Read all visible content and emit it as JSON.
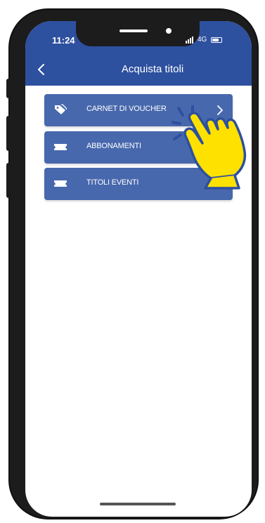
{
  "status_bar": {
    "time": "11:24",
    "network": "4G"
  },
  "header": {
    "title": "Acquista titoli",
    "back_icon": "chevron-left-icon"
  },
  "menu": {
    "items": [
      {
        "label": "CARNET DI VOUCHER",
        "icon": "tag-icon"
      },
      {
        "label": "ABBONAMENTI",
        "icon": "ticket-icon"
      },
      {
        "label": "TITOLI EVENTI",
        "icon": "ticket-icon"
      }
    ]
  },
  "colors": {
    "primary": "#2d509f",
    "button": "#4868ad",
    "hand": "#ffe100"
  }
}
